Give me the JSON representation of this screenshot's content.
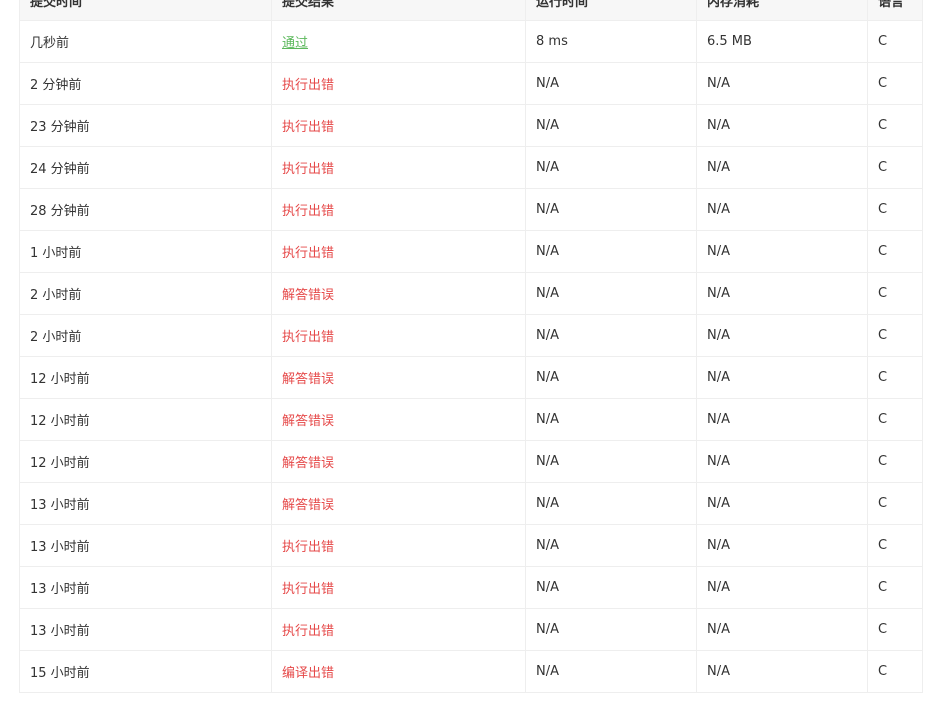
{
  "colors": {
    "accepted": "#5cb85c",
    "error": "#e64a4a",
    "header_bg": "#f7f7f7",
    "border": "#eeeeee"
  },
  "table": {
    "headers": [
      "提交时间",
      "提交结果",
      "运行时间",
      "内存消耗",
      "语言"
    ],
    "rows": [
      {
        "time": "几秒前",
        "status": "通过",
        "status_kind": "accepted",
        "runtime": "8 ms",
        "memory": "6.5 MB",
        "lang": "C"
      },
      {
        "time": "2 分钟前",
        "status": "执行出错",
        "status_kind": "error",
        "runtime": "N/A",
        "memory": "N/A",
        "lang": "C"
      },
      {
        "time": "23 分钟前",
        "status": "执行出错",
        "status_kind": "error",
        "runtime": "N/A",
        "memory": "N/A",
        "lang": "C"
      },
      {
        "time": "24 分钟前",
        "status": "执行出错",
        "status_kind": "error",
        "runtime": "N/A",
        "memory": "N/A",
        "lang": "C"
      },
      {
        "time": "28 分钟前",
        "status": "执行出错",
        "status_kind": "error",
        "runtime": "N/A",
        "memory": "N/A",
        "lang": "C"
      },
      {
        "time": "1 小时前",
        "status": "执行出错",
        "status_kind": "error",
        "runtime": "N/A",
        "memory": "N/A",
        "lang": "C"
      },
      {
        "time": "2 小时前",
        "status": "解答错误",
        "status_kind": "error",
        "runtime": "N/A",
        "memory": "N/A",
        "lang": "C"
      },
      {
        "time": "2 小时前",
        "status": "执行出错",
        "status_kind": "error",
        "runtime": "N/A",
        "memory": "N/A",
        "lang": "C"
      },
      {
        "time": "12 小时前",
        "status": "解答错误",
        "status_kind": "error",
        "runtime": "N/A",
        "memory": "N/A",
        "lang": "C"
      },
      {
        "time": "12 小时前",
        "status": "解答错误",
        "status_kind": "error",
        "runtime": "N/A",
        "memory": "N/A",
        "lang": "C"
      },
      {
        "time": "12 小时前",
        "status": "解答错误",
        "status_kind": "error",
        "runtime": "N/A",
        "memory": "N/A",
        "lang": "C"
      },
      {
        "time": "13 小时前",
        "status": "解答错误",
        "status_kind": "error",
        "runtime": "N/A",
        "memory": "N/A",
        "lang": "C"
      },
      {
        "time": "13 小时前",
        "status": "执行出错",
        "status_kind": "error",
        "runtime": "N/A",
        "memory": "N/A",
        "lang": "C"
      },
      {
        "time": "13 小时前",
        "status": "执行出错",
        "status_kind": "error",
        "runtime": "N/A",
        "memory": "N/A",
        "lang": "C"
      },
      {
        "time": "13 小时前",
        "status": "执行出错",
        "status_kind": "error",
        "runtime": "N/A",
        "memory": "N/A",
        "lang": "C"
      },
      {
        "time": "15 小时前",
        "status": "编译出错",
        "status_kind": "error",
        "runtime": "N/A",
        "memory": "N/A",
        "lang": "C"
      }
    ]
  }
}
